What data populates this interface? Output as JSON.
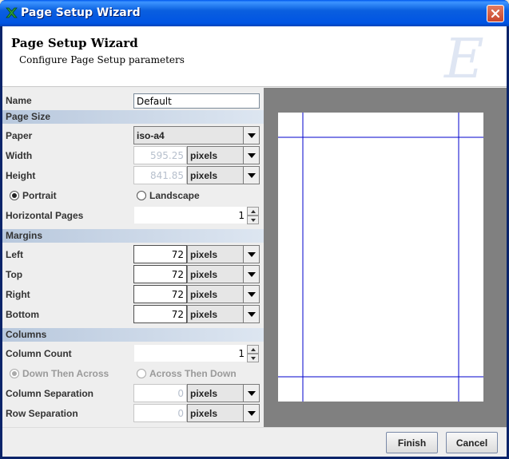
{
  "window": {
    "title": "Page Setup Wizard"
  },
  "header": {
    "title": "Page Setup Wizard",
    "subtitle": "Configure Page Setup parameters",
    "logo_letter": "E"
  },
  "form": {
    "name": {
      "label": "Name",
      "value": "Default"
    },
    "page_size": {
      "section": "Page Size",
      "paper": {
        "label": "Paper",
        "value": "iso-a4"
      },
      "width": {
        "label": "Width",
        "value": "595.25",
        "unit": "pixels"
      },
      "height": {
        "label": "Height",
        "value": "841.85",
        "unit": "pixels"
      },
      "portrait": {
        "label": "Portrait",
        "selected": true
      },
      "landscape": {
        "label": "Landscape",
        "selected": false
      },
      "horizontal_pages": {
        "label": "Horizontal Pages",
        "value": "1"
      }
    },
    "margins": {
      "section": "Margins",
      "left": {
        "label": "Left",
        "value": "72",
        "unit": "pixels"
      },
      "top": {
        "label": "Top",
        "value": "72",
        "unit": "pixels"
      },
      "right": {
        "label": "Right",
        "value": "72",
        "unit": "pixels"
      },
      "bottom": {
        "label": "Bottom",
        "value": "72",
        "unit": "pixels"
      }
    },
    "columns": {
      "section": "Columns",
      "column_count": {
        "label": "Column Count",
        "value": "1"
      },
      "down_then_across": {
        "label": "Down Then Across",
        "selected": true,
        "disabled": true
      },
      "across_then_down": {
        "label": "Across Then Down",
        "selected": false,
        "disabled": true
      },
      "column_separation": {
        "label": "Column Separation",
        "value": "0",
        "unit": "pixels"
      },
      "row_separation": {
        "label": "Row Separation",
        "value": "0",
        "unit": "pixels"
      }
    }
  },
  "footer": {
    "finish": "Finish",
    "cancel": "Cancel"
  },
  "colors": {
    "titlebar": "#0054e3",
    "section_bar": "#b8c8dd",
    "preview_bg": "#808080",
    "margin_guide": "#0000cc"
  }
}
